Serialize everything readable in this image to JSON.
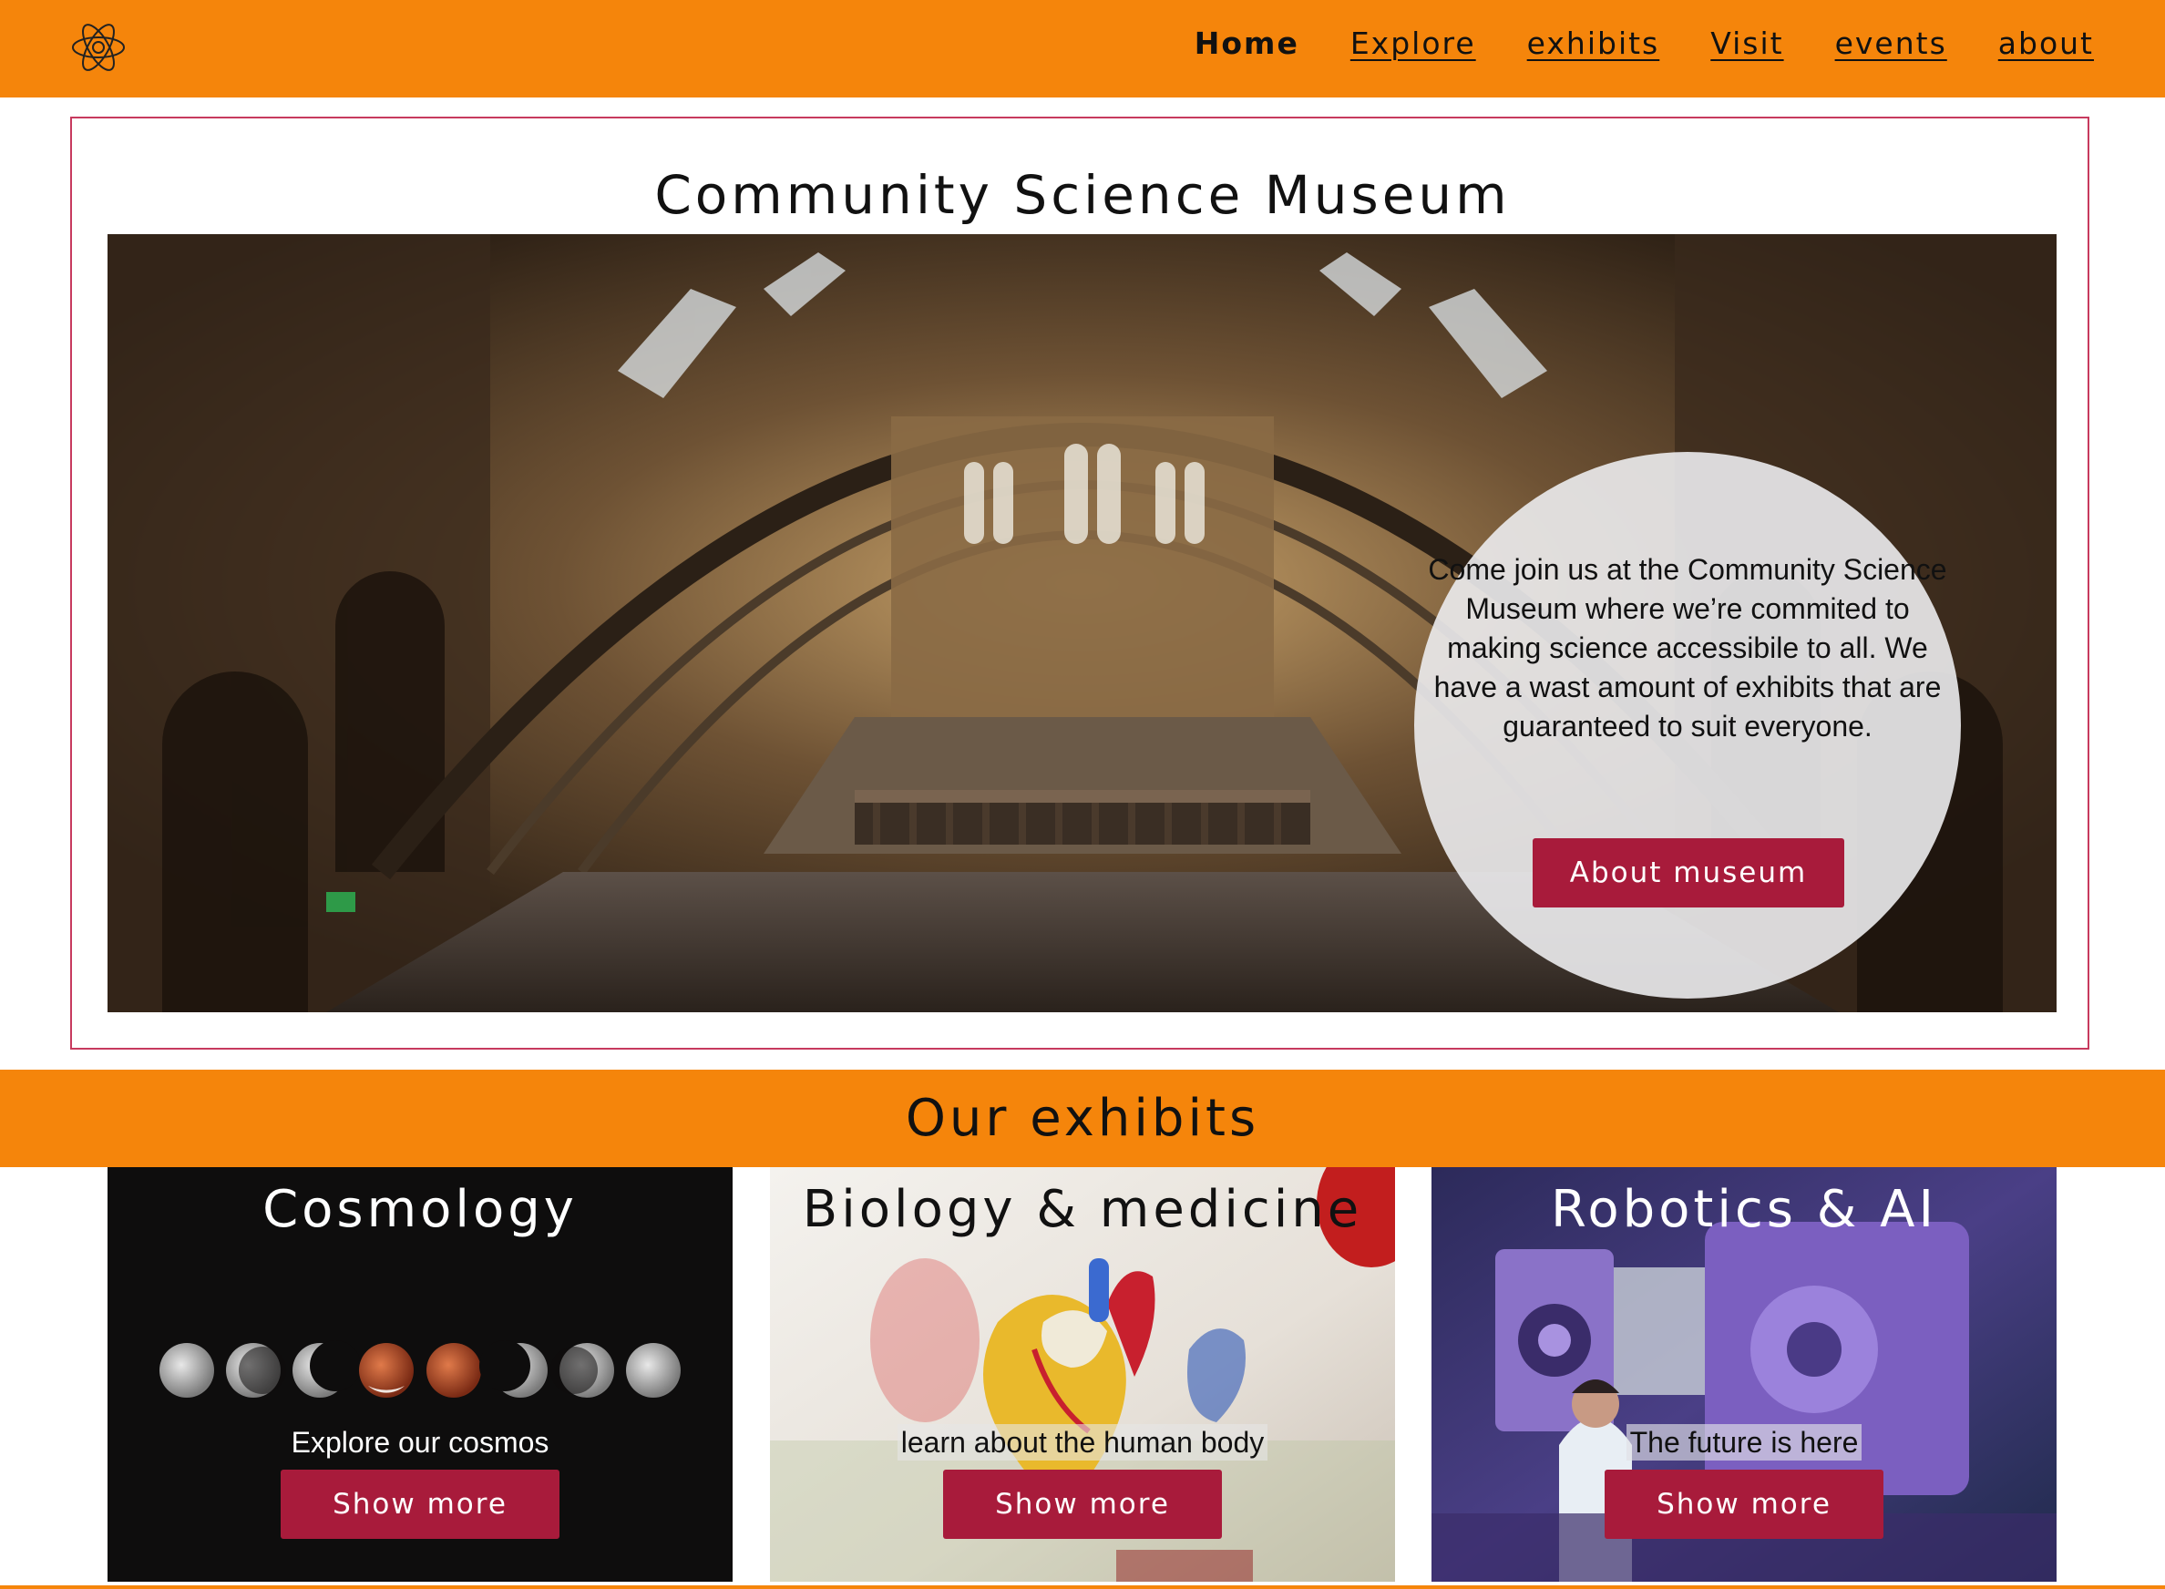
{
  "header": {
    "logo_icon": "atom-icon",
    "nav": [
      {
        "label": "Home",
        "active": true
      },
      {
        "label": "Explore",
        "active": false
      },
      {
        "label": "exhibits",
        "active": false
      },
      {
        "label": "Visit",
        "active": false
      },
      {
        "label": "events",
        "active": false
      },
      {
        "label": "about",
        "active": false
      }
    ]
  },
  "hero": {
    "title": "Community Science Museum",
    "intro": "Come join us at the Community Science Museum where we’re commited to making science accessibile to all. We have a wast amount of exhibits that are guaranteed to suit everyone.",
    "button_label": "About museum"
  },
  "exhibits": {
    "title": "Our exhibits",
    "cards": [
      {
        "title": "Cosmology",
        "subtitle": "Explore our cosmos",
        "button_label": "Show more"
      },
      {
        "title": "Biology & medicine",
        "subtitle": "learn about the human body",
        "button_label": "Show more"
      },
      {
        "title": "Robotics & AI",
        "subtitle": "The future is here",
        "button_label": "Show more"
      }
    ]
  },
  "colors": {
    "brand_orange": "#f5850b",
    "button_red": "#a81b3b",
    "frame_border": "#c73a5e"
  }
}
